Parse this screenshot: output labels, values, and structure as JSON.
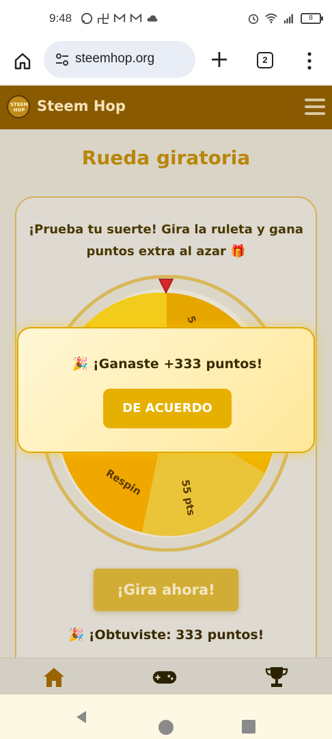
{
  "status_bar": {
    "time": "9:48",
    "battery": "8",
    "icons_left": [
      "whatsapp-icon",
      "pinwheel-icon",
      "gmail-icon",
      "gmail-icon",
      "cloud-icon"
    ],
    "icons_right": [
      "alarm-icon",
      "wifi-icon",
      "signal-icon",
      "battery-icon"
    ]
  },
  "browser": {
    "url": "steemhop.org",
    "tab_count": "2"
  },
  "site": {
    "name": "Steem Hop",
    "logo_text": "STEEM HOP"
  },
  "page": {
    "title": "Rueda giratoria",
    "description": "¡Prueba tu suerte! Gira la ruleta y gana puntos extra al azar 🎁",
    "spin_button": "¡Gira ahora!",
    "result": "🎉 ¡Obtuviste: 333 puntos!"
  },
  "wheel": {
    "visible_labels": [
      "55 pts",
      "Respin",
      "5"
    ],
    "colors": {
      "rim": "#d9b85a",
      "segment_dark": "#e6a000",
      "segment_light": "#f2c200",
      "segment_yellow": "#f5d63a",
      "pointer": "#d9262b"
    }
  },
  "modal": {
    "message": "🎉 ¡Ganaste +333 puntos!",
    "button": "DE ACUERDO"
  },
  "bottom_nav": {
    "items": [
      "home-icon",
      "gamepad-icon",
      "trophy-icon"
    ]
  },
  "colors": {
    "header_bg": "#8a5a00",
    "accent": "#b8860b",
    "modal_button": "#e6b000"
  }
}
